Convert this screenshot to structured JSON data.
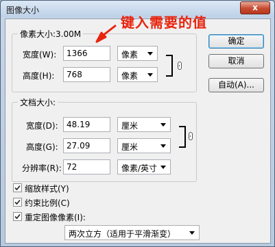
{
  "dialog": {
    "title": "图像大小",
    "close_label": "x"
  },
  "pixel_dims": {
    "group_title": "像素大小:3.00M",
    "width_label": "宽度(W):",
    "width_value": "1366",
    "width_unit": "像素",
    "height_label": "高度(H):",
    "height_value": "768",
    "height_unit": "像素"
  },
  "doc_size": {
    "group_title": "文档大小:",
    "width_label": "宽度(D):",
    "width_value": "48.19",
    "width_unit": "厘米",
    "height_label": "高度(G):",
    "height_value": "27.09",
    "height_unit": "厘米",
    "resolution_label": "分辨率(R):",
    "resolution_value": "72",
    "resolution_unit": "像素/英寸"
  },
  "buttons": {
    "ok": "确定",
    "cancel": "取消",
    "auto": "自动(A)..."
  },
  "options": {
    "scale_styles": {
      "label": "缩放样式(Y)",
      "checked": true
    },
    "constrain": {
      "label": "约束比例(C)",
      "checked": true
    },
    "resample": {
      "label": "重定图像像素(I):",
      "checked": true
    },
    "resample_method": "两次立方（适用于平滑渐变）"
  },
  "annotation": {
    "text": "键入需要的值",
    "color": "#e8240e"
  }
}
